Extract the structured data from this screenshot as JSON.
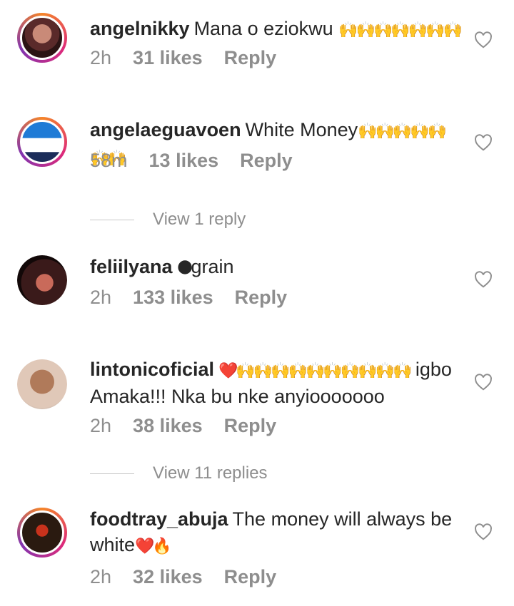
{
  "comments": [
    {
      "username": "angelnikky",
      "text": "Mana o eziokwu ",
      "emoji": "🙌🙌🙌🙌🙌🙌🙌",
      "time": "2h",
      "likes": "31 likes",
      "reply": "Reply",
      "icon": "heart-outline-icon"
    },
    {
      "username": "angelaeguavoen",
      "text": "White Money",
      "emoji": "🙌🙌🙌🙌🙌🙌🙌",
      "time": "58m",
      "likes": "13 likes",
      "reply": "Reply",
      "icon": "heart-outline-icon"
    },
    {
      "username": "feliilyana",
      "text": "grain",
      "emoji": "🌑",
      "time": "2h",
      "likes": "133 likes",
      "reply": "Reply",
      "icon": "heart-outline-icon"
    },
    {
      "username": "lintonicoficial",
      "text": " igbo Amaka!!! Nka bu nke anyiooooooo",
      "emoji": "❤️🙌🙌🙌🙌🙌🙌🙌🙌🙌🙌",
      "time": "2h",
      "likes": "38 likes",
      "reply": "Reply",
      "icon": "heart-outline-icon"
    },
    {
      "username": "foodtray_abuja",
      "text": "The money will always be white",
      "emoji": "❤️🔥",
      "time": "2h",
      "likes": "32 likes",
      "reply": "Reply",
      "icon": "heart-outline-icon"
    }
  ],
  "view_replies": [
    "View 1 reply",
    "View 11 replies"
  ],
  "colors": {
    "text": "#262626",
    "secondary": "#8e8e8e",
    "divider": "#c7c7c7"
  }
}
